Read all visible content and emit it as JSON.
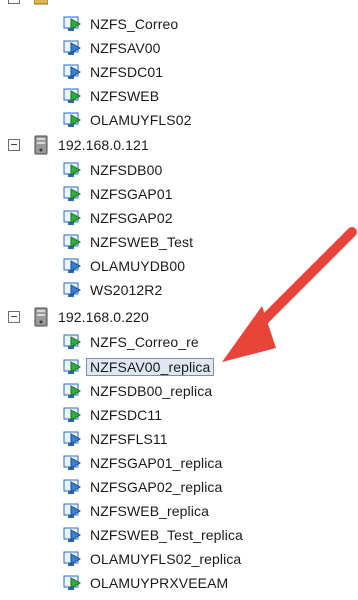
{
  "tree": {
    "top_partial": {
      "label": "NZFS_Correo"
    },
    "groups": [
      {
        "host": "",
        "vms": [
          {
            "name": "NZFS_Correo",
            "state": "on"
          },
          {
            "name": "NZFSAV00",
            "state": "off"
          },
          {
            "name": "NZFSDC01",
            "state": "off"
          },
          {
            "name": "NZFSWEB",
            "state": "on"
          },
          {
            "name": "OLAMUYFLS02",
            "state": "on"
          }
        ]
      },
      {
        "host": "192.168.0.121",
        "vms": [
          {
            "name": "NZFSDB00",
            "state": "on"
          },
          {
            "name": "NZFSGAP01",
            "state": "on"
          },
          {
            "name": "NZFSGAP02",
            "state": "on"
          },
          {
            "name": "NZFSWEB_Test",
            "state": "on"
          },
          {
            "name": "OLAMUYDB00",
            "state": "off"
          },
          {
            "name": "WS2012R2",
            "state": "off"
          }
        ]
      },
      {
        "host": "192.168.0.220",
        "vms": [
          {
            "name": "NZFS_Correo_re",
            "state": "on"
          },
          {
            "name": "NZFSAV00_replica",
            "state": "on",
            "selected": true
          },
          {
            "name": "NZFSDB00_replica",
            "state": "on"
          },
          {
            "name": "NZFSDC11",
            "state": "on"
          },
          {
            "name": "NZFSFLS11",
            "state": "off"
          },
          {
            "name": "NZFSGAP01_replica",
            "state": "off"
          },
          {
            "name": "NZFSGAP02_replica",
            "state": "off"
          },
          {
            "name": "NZFSWEB_replica",
            "state": "off"
          },
          {
            "name": "NZFSWEB_Test_replica",
            "state": "off"
          },
          {
            "name": "OLAMUYFLS02_replica",
            "state": "off"
          },
          {
            "name": "OLAMUYPRXVEEAM",
            "state": "on"
          }
        ]
      }
    ],
    "expander_symbol": "⊟"
  },
  "colors": {
    "vm_on": "#2fae3a",
    "vm_off_blue": "#3a7fd0",
    "arrow": "#e8443a",
    "selection_bg": "#dfe7f3"
  },
  "icons": {
    "host": "server-tower-icon",
    "vm_on": "vm-running-icon",
    "vm_off": "vm-stopped-icon",
    "collapse": "collapse-minus-icon",
    "annotation": "red-arrow-icon"
  }
}
